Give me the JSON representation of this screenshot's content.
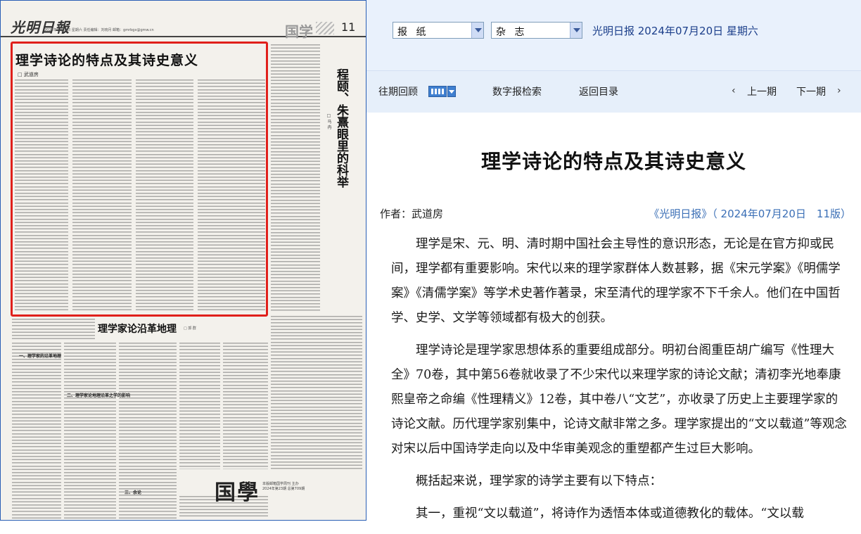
{
  "newspaper_page": {
    "masthead_logo": "光明日報",
    "masthead_info": "2024年7月20日  星期六  责任编辑：刘晓月  邮箱：gmrbgx@gmw.cn",
    "section": "国学",
    "page_number": "11",
    "highlighted_article": {
      "title": "理学诗论的特点及其诗史意义",
      "byline": "□ 武道房"
    },
    "side_article": {
      "title": "程颐、朱熹眼里的科举",
      "byline": "□ 马 冉"
    },
    "second_article": {
      "title": "理学家论沿革地理",
      "byline": "□ 郭 群",
      "subheads": [
        "一、理学家的沿革地理",
        "二、理学家论地理沿革之学的影响",
        "三、余论"
      ]
    },
    "bottom_logo": "国學",
    "bottom_info": [
      "本版邮箱国学周刊 主办",
      "2024年第23期 总第709期"
    ]
  },
  "toolbar": {
    "select_newspaper": "报 纸",
    "select_magazine": "杂 志",
    "paper_date": "光明日报 2024年07月20日 星期六"
  },
  "nav": {
    "back_issue": "往期回顾",
    "search": "数字报检索",
    "back_to_index": "返回目录",
    "prev_issue": "上一期",
    "next_issue": "下一期",
    "prev_chevron": "‹",
    "next_chevron": "›"
  },
  "article": {
    "title": "理学诗论的特点及其诗史意义",
    "author": "作者：武道房",
    "source": "《光明日报》（ 2024年07月20日　11版）",
    "paragraphs": [
      "理学是宋、元、明、清时期中国社会主导性的意识形态，无论是在官方抑或民间，理学都有重要影响。宋代以来的理学家群体人数甚夥，据《宋元学案》《明儒学案》《清儒学案》等学术史著作著录，宋至清代的理学家不下千余人。他们在中国哲学、史学、文学等领域都有极大的创获。",
      "理学诗论是理学家思想体系的重要组成部分。明初台阁重臣胡广编写《性理大全》70卷，其中第56卷就收录了不少宋代以来理学家的诗论文献；清初李光地奉康熙皇帝之命编《性理精义》12卷，其中卷八“文艺”，亦收录了历史上主要理学家的诗论文献。历代理学家别集中，论诗文献非常之多。理学家提出的“文以载道”等观念对宋以后中国诗学走向以及中华审美观念的重塑都产生过巨大影响。",
      "概括起来说，理学家的诗学主要有以下特点：",
      "其一，重视“文以载道”，将诗作为透悟本体或道德教化的载体。“文以载"
    ]
  }
}
